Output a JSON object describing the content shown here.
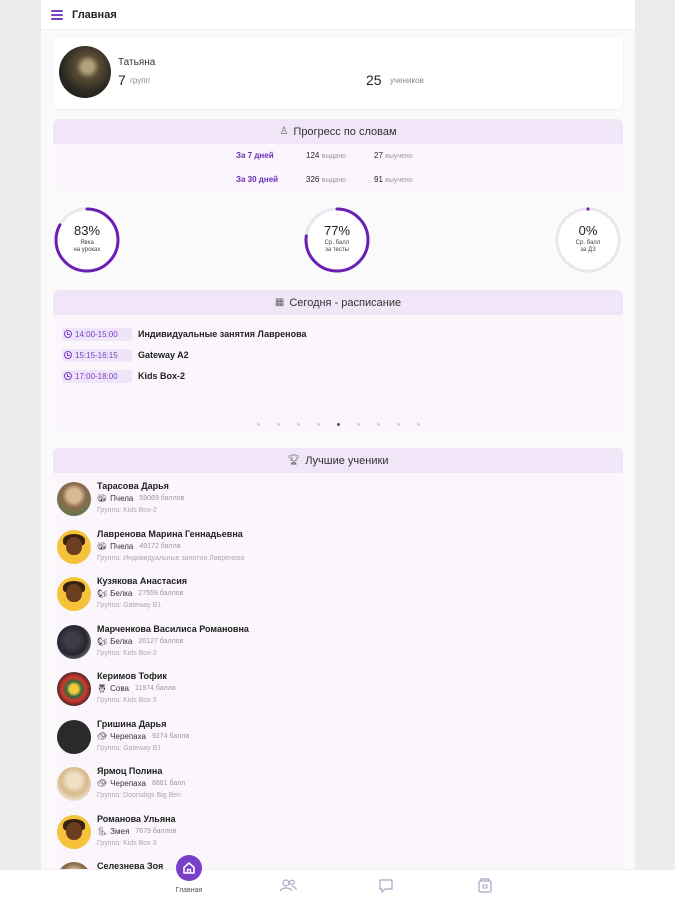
{
  "header": {
    "title": "Главная",
    "menu_icon": "hamburger-menu-icon"
  },
  "profile": {
    "name": "Татьяна",
    "groups_count": "7",
    "groups_label": "групп",
    "students_count": "25",
    "students_label": "учеников"
  },
  "progress": {
    "title": "Прогресс по словам",
    "icon": "user-icon",
    "rows": [
      {
        "period": "За 7 дней",
        "issued": "124",
        "issued_label": "выдано",
        "learned": "27",
        "learned_label": "выучено"
      },
      {
        "period": "За 30 дней",
        "issued": "326",
        "issued_label": "выдано",
        "learned": "91",
        "learned_label": "выучено"
      }
    ]
  },
  "metrics": [
    {
      "value": "83%",
      "fraction": 0.83,
      "caption1": "Явка",
      "caption2": "на уроках"
    },
    {
      "value": "77%",
      "fraction": 0.77,
      "caption1": "Ср. балл",
      "caption2": "за тесты"
    },
    {
      "value": "0%",
      "fraction": 0.0,
      "caption1": "Ср. балл",
      "caption2": "за ДЗ"
    }
  ],
  "schedule": {
    "title": "Сегодня  - расписание",
    "icon": "calendar-icon",
    "items": [
      {
        "time": "14:00-15:00",
        "name": "Индивидуальные занятия Лавренова"
      },
      {
        "time": "15:15-16:15",
        "name": "Gateway A2"
      },
      {
        "time": "17:00-18:00",
        "name": "Kids Box-2"
      }
    ],
    "pager_count": 9,
    "pager_active": 4
  },
  "best": {
    "title": "Лучшие ученики",
    "icon": "trophy-icon",
    "students": [
      {
        "name": "Тарасова Дарья",
        "level": "Пчела",
        "level_icon": "bee-icon",
        "points": "59069 баллов",
        "group": "Группа: Kids Box-2",
        "avatar": "photo1"
      },
      {
        "name": "Лавренова Марина Геннадьевна",
        "level": "Пчела",
        "level_icon": "bee-icon",
        "points": "49172 балла",
        "group": "Группа: Индивидуальные занятия Лавренова",
        "avatar": "yellow"
      },
      {
        "name": "Кузякова Анастасия",
        "level": "Белка",
        "level_icon": "squirrel-icon",
        "points": "27559 баллов",
        "group": "Группа: Gateway B1",
        "avatar": "yellow"
      },
      {
        "name": "Марченкова Василиса Романовна",
        "level": "Белка",
        "level_icon": "squirrel-icon",
        "points": "20127 баллов",
        "group": "Группа: Kids Box-2",
        "avatar": "photo2"
      },
      {
        "name": "Керимов Тофик",
        "level": "Сова",
        "level_icon": "owl-icon",
        "points": "11974 балла",
        "group": "Группа: Kids Box 3",
        "avatar": "mario"
      },
      {
        "name": "Гришина Дарья",
        "level": "Черепаха",
        "level_icon": "turtle-icon",
        "points": "9274 балла",
        "group": "Группа: Gateway B1",
        "avatar": "dark"
      },
      {
        "name": "Ярмоц Полина",
        "level": "Черепаха",
        "level_icon": "turtle-icon",
        "points": "8881 балл",
        "group": "Группа: Doorsdigs Big Ben",
        "avatar": "blond"
      },
      {
        "name": "Романова Ульяна",
        "level": "Змея",
        "level_icon": "snake-icon",
        "points": "7679 баллов",
        "group": "Группа: Kids Box 3",
        "avatar": "yellow"
      },
      {
        "name": "Селезнева Зоя",
        "level": "",
        "level_icon": "",
        "points": "",
        "group": "",
        "avatar": "photo1"
      }
    ]
  },
  "bottom_nav": [
    {
      "label": "Главная",
      "icon": "home-icon",
      "active": true
    },
    {
      "label": "",
      "icon": "users-icon",
      "active": false
    },
    {
      "label": "",
      "icon": "chat-icon",
      "active": false
    },
    {
      "label": "",
      "icon": "wallet-icon",
      "active": false
    }
  ],
  "colors": {
    "accent": "#7a3fc9",
    "card_header": "#f0e6f7",
    "card_bg": "#faf6fc"
  }
}
